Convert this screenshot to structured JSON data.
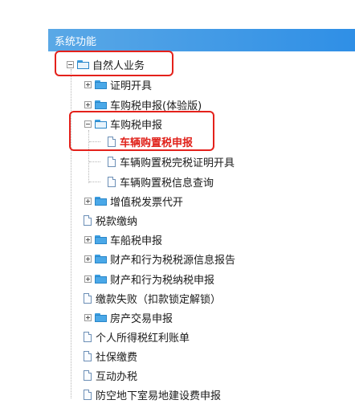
{
  "header": {
    "title": "系统功能"
  },
  "tree": {
    "root": "自然人业务",
    "zmkj": "证明开具",
    "cgssb_ty": "车购税申报(体验版)",
    "cgssb": "车购税申报",
    "clgzssb": "车辆购置税申报",
    "clgzs_wszm": "车辆购置税完税证明开具",
    "clgzs_cx": "车辆购置税信息查询",
    "zzsfpdk": "增值税发票代开",
    "skjn": "税款缴纳",
    "ccssb": "车船税申报",
    "ccxwsy_bg": "财产和行为税税源信息报告",
    "ccxwsn_sb": "财产和行为税纳税申报",
    "jksb": "缴款失败（扣款锁定解锁）",
    "fcjy": "房产交易申报",
    "grsdhl": "个人所得税红利账单",
    "sbjf": "社保缴费",
    "hdbs": "互动办税",
    "fkdx": "防空地下室易地建设费申报"
  }
}
